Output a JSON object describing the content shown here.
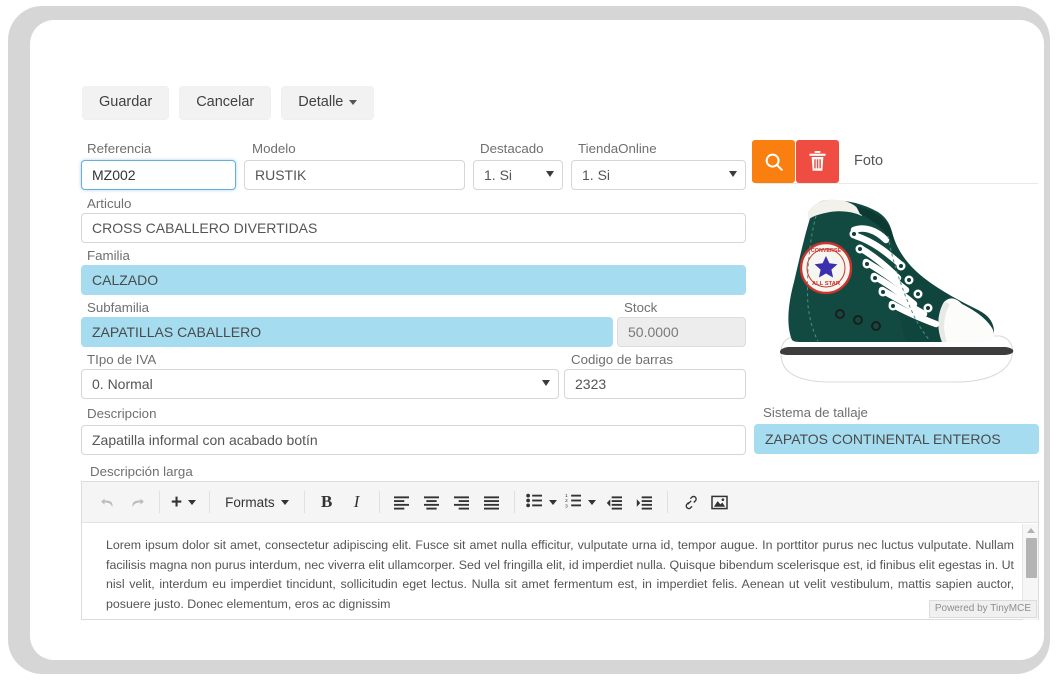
{
  "toolbar": {
    "save_label": "Guardar",
    "cancel_label": "Cancelar",
    "detail_label": "Detalle"
  },
  "form": {
    "referencia": {
      "label": "Referencia",
      "value": "MZ002"
    },
    "modelo": {
      "label": "Modelo",
      "value": "RUSTIK"
    },
    "destacado": {
      "label": "Destacado",
      "value": "1. Si"
    },
    "tienda_online": {
      "label": "TiendaOnline",
      "value": "1. Si"
    },
    "articulo": {
      "label": "Articulo",
      "value": "CROSS CABALLERO DIVERTIDAS"
    },
    "familia": {
      "label": "Familia",
      "value": "CALZADO"
    },
    "subfamilia": {
      "label": "Subfamilia",
      "value": "ZAPATILLAS CABALLERO"
    },
    "stock": {
      "label": "Stock",
      "value": "50.0000"
    },
    "tipo_iva": {
      "label": "TIpo de IVA",
      "value": "0. Normal"
    },
    "codigo_barras": {
      "label": "Codigo de barras",
      "value": "2323"
    },
    "descripcion": {
      "label": "Descripcion",
      "value": "Zapatilla informal con acabado botín"
    },
    "sistema_tallaje": {
      "label": "Sistema de tallaje",
      "value": "ZAPATOS CONTINENTAL ENTEROS"
    },
    "descripcion_larga": {
      "label": "Descripción larga"
    }
  },
  "photo": {
    "label": "Foto",
    "alt": "green-converse-high-top-sneaker",
    "search_icon": "search-icon",
    "delete_icon": "trash-icon",
    "search_button_color": "#f97f10",
    "delete_button_color": "#ef4c42"
  },
  "editor": {
    "undo_icon": "undo-icon",
    "redo_icon": "redo-icon",
    "insert_label": "",
    "formats_label": "Formats",
    "bold_label": "B",
    "italic_label": "I",
    "align_left_icon": "align-left-icon",
    "align_center_icon": "align-center-icon",
    "align_right_icon": "align-right-icon",
    "align_justify_icon": "align-justify-icon",
    "bullet_list_icon": "bullet-list-icon",
    "numbered_list_icon": "numbered-list-icon",
    "outdent_icon": "outdent-icon",
    "indent_icon": "indent-icon",
    "link_icon": "link-icon",
    "image_icon": "image-icon",
    "content": "Lorem ipsum dolor sit amet, consectetur adipiscing elit. Fusce sit amet nulla efficitur, vulputate urna id, tempor augue. In porttitor purus nec luctus vulputate. Nullam facilisis magna non purus interdum, nec viverra elit ullamcorper. Sed vel fringilla elit, id imperdiet nulla. Quisque bibendum scelerisque est, id finibus elit egestas in. Ut nisl velit, interdum eu imperdiet tincidunt, sollicitudin eget lectus. Nulla sit amet fermentum est, in imperdiet felis. Aenean ut velit vestibulum, mattis sapien auctor, posuere justo. Donec elementum, eros ac dignissim",
    "badge": "Powered by TinyMCE"
  },
  "colors": {
    "highlight_field": "#a5dcef",
    "focus_border": "#63b0e0",
    "frame": "#d6d6d6"
  }
}
